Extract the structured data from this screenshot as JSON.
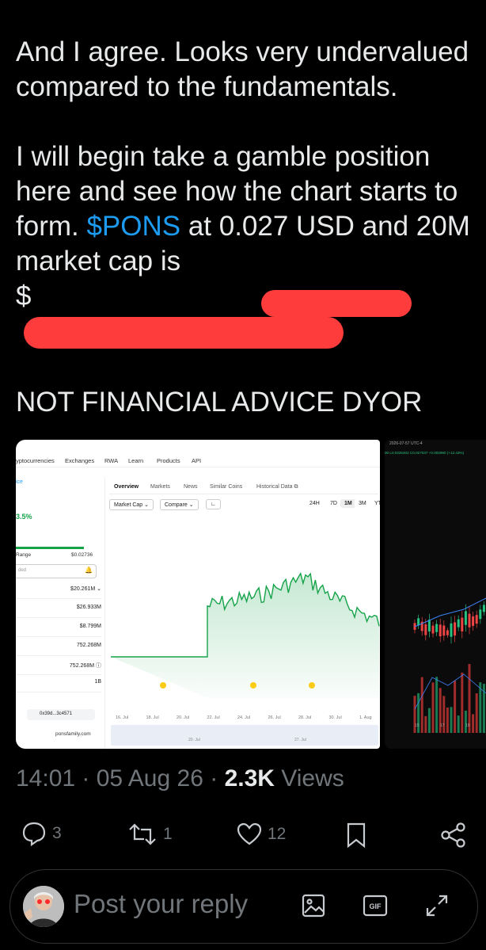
{
  "tweet": {
    "para1": "And I agree. Looks very undervalued compared to the fundamentals.",
    "para2_a": "I will begin take a gamble position here and see how the chart starts to form. ",
    "cashtag": "$PONS",
    "para2_b": " at 0.027 USD and 20M market cap is",
    "para2_c": "$",
    "para3": "NOT FINANCIAL ADVICE DYOR"
  },
  "screenshot1": {
    "nav": [
      "yptocurrencies",
      "Exchanges",
      "RWA",
      "Learn",
      "Products",
      "API"
    ],
    "side_top": "ice",
    "percent": "3.5%",
    "range_label": "Range",
    "range_value": "$0.02736",
    "input_hint": "ded",
    "rows": [
      "$20.261M",
      "$26.933M",
      "$8.799M",
      "752.268M",
      "752.268M",
      "1B"
    ],
    "address": "0x39d...3c4571",
    "website": "ponsfamily.com",
    "tabs": [
      "Overview",
      "Markets",
      "News",
      "Similar Coins",
      "Historical Data"
    ],
    "dropdowns": [
      "Market Cap",
      "Compare"
    ],
    "timeframes": [
      "24H",
      "7D",
      "1M",
      "3M",
      "YT"
    ],
    "x_ticks": [
      "16. Jul",
      "18. Jul",
      "20. Jul",
      "22. Jul",
      "24. Jul",
      "26. Jul",
      "28. Jul",
      "30. Jul",
      "1. Aug"
    ],
    "mini_ticks": [
      "20. Jul",
      "27. Jul"
    ]
  },
  "screenshot2": {
    "header": "2026-07-57 UTC-4",
    "ohlc": "00  L0.0226402  C0.027037  +0.002990 (+12.43%)",
    "x_ticks": [
      "15",
      "17",
      "19"
    ]
  },
  "meta": {
    "time": "14:01",
    "date": "05 Aug 26",
    "views_count": "2.3K",
    "views_label": "Views"
  },
  "actions": {
    "replies": "3",
    "reposts": "1",
    "likes": "12"
  },
  "reply": {
    "placeholder": "Post your reply"
  },
  "colors": {
    "accent": "#1d9bf0",
    "redaction": "#ff3c3c",
    "chart_line": "#16a34a"
  }
}
